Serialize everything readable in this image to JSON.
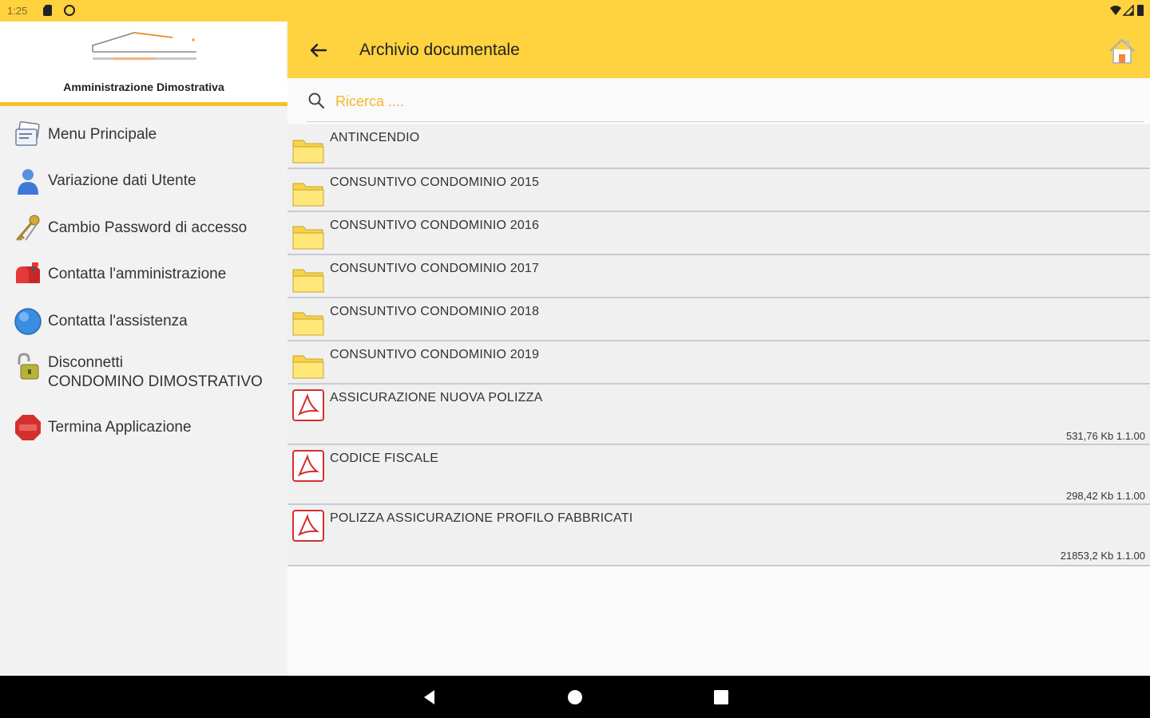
{
  "status_bar": {
    "time": "1:25"
  },
  "drawer": {
    "org_name": "Amministrazione Dimostrativa",
    "items": [
      {
        "label": "Menu Principale",
        "icon": "menu-cards-icon"
      },
      {
        "label": "Variazione dati Utente",
        "icon": "user-icon"
      },
      {
        "label": "Cambio Password di accesso",
        "icon": "key-icon"
      },
      {
        "label": "Contatta l'amministrazione",
        "icon": "mailbox-icon"
      },
      {
        "label": "Contatta l'assistenza",
        "icon": "help-globe-icon"
      },
      {
        "label": "Disconnetti",
        "label2": "CONDOMINO DIMOSTRATIVO",
        "icon": "padlock-open-icon"
      },
      {
        "label": "Termina Applicazione",
        "icon": "stop-sign-icon"
      }
    ]
  },
  "appbar": {
    "title": "Archivio documentale"
  },
  "search": {
    "placeholder": "Ricerca ....",
    "value": ""
  },
  "documents": [
    {
      "name": "ANTINCENDIO",
      "type": "folder",
      "meta": ""
    },
    {
      "name": "CONSUNTIVO CONDOMINIO 2015",
      "type": "folder",
      "meta": ""
    },
    {
      "name": "CONSUNTIVO CONDOMINIO 2016",
      "type": "folder",
      "meta": ""
    },
    {
      "name": "CONSUNTIVO CONDOMINIO 2017",
      "type": "folder",
      "meta": ""
    },
    {
      "name": "CONSUNTIVO CONDOMINIO 2018",
      "type": "folder",
      "meta": ""
    },
    {
      "name": "CONSUNTIVO CONDOMINIO 2019",
      "type": "folder",
      "meta": ""
    },
    {
      "name": "ASSICURAZIONE NUOVA POLIZZA",
      "type": "pdf",
      "meta": "531,76 Kb 1.1.00"
    },
    {
      "name": "CODICE FISCALE",
      "type": "pdf",
      "meta": "298,42 Kb 1.1.00"
    },
    {
      "name": "POLIZZA ASSICURAZIONE PROFILO FABBRICATI",
      "type": "pdf",
      "meta": "21853,2 Kb 1.1.00"
    }
  ],
  "colors": {
    "accent": "#ffd23f",
    "accent_dark": "#f5c02a",
    "folder": "#ffe566",
    "pdf": "#d32f2f"
  }
}
